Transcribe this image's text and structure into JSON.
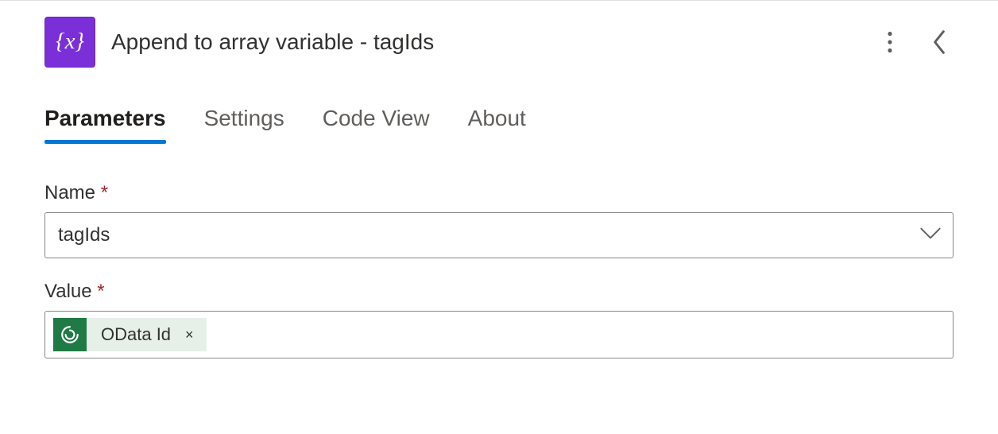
{
  "header": {
    "title": "Append to array variable - tagIds"
  },
  "tabs": [
    {
      "label": "Parameters",
      "active": true
    },
    {
      "label": "Settings",
      "active": false
    },
    {
      "label": "Code View",
      "active": false
    },
    {
      "label": "About",
      "active": false
    }
  ],
  "fields": {
    "name": {
      "label": "Name",
      "required_mark": "*",
      "value": "tagIds"
    },
    "value": {
      "label": "Value",
      "required_mark": "*",
      "token": {
        "label": "OData Id",
        "remove_symbol": "×"
      }
    }
  }
}
